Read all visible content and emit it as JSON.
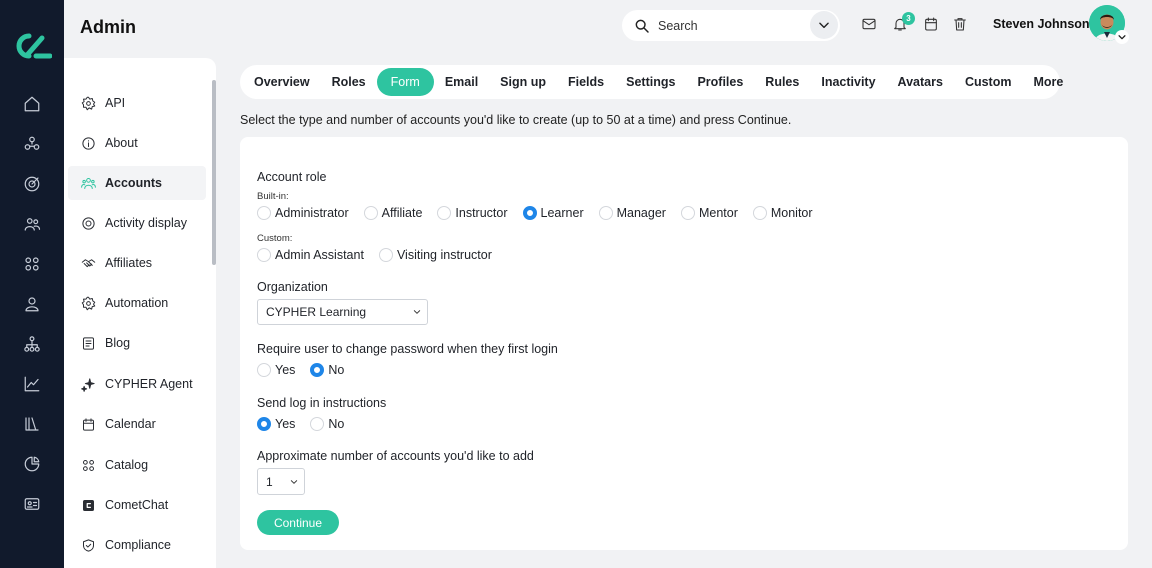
{
  "app": {
    "title": "Admin"
  },
  "header": {
    "search_placeholder": "Search",
    "notifications_count": "3",
    "user_name": "Steven Johnson"
  },
  "rail": {
    "icons": [
      "home-icon",
      "network-icon",
      "target-icon",
      "users-icon",
      "grid-icon",
      "user-icon",
      "hierarchy-icon",
      "chart-icon",
      "library-icon",
      "pie-icon",
      "id-card-icon"
    ]
  },
  "subnav": {
    "items": [
      {
        "label": "API",
        "icon": "gear-icon"
      },
      {
        "label": "About",
        "icon": "info-icon"
      },
      {
        "label": "Accounts",
        "icon": "users-icon",
        "active": true
      },
      {
        "label": "Activity display",
        "icon": "target-icon"
      },
      {
        "label": "Affiliates",
        "icon": "handshake-icon"
      },
      {
        "label": "Automation",
        "icon": "gear-icon"
      },
      {
        "label": "Blog",
        "icon": "document-icon"
      },
      {
        "label": "CYPHER Agent",
        "icon": "sparkle-icon"
      },
      {
        "label": "Calendar",
        "icon": "calendar-icon"
      },
      {
        "label": "Catalog",
        "icon": "grid-icon"
      },
      {
        "label": "CometChat",
        "icon": "chat-icon"
      },
      {
        "label": "Compliance",
        "icon": "shield-icon"
      }
    ]
  },
  "tabs": [
    "Overview",
    "Roles",
    "Form",
    "Email",
    "Sign up",
    "Fields",
    "Settings",
    "Profiles",
    "Rules",
    "Inactivity",
    "Avatars",
    "Custom",
    "More"
  ],
  "active_tab": "Form",
  "instructions": "Select the type and number of accounts you'd like to create (up to 50 at a time) and press Continue.",
  "form": {
    "account_role_label": "Account role",
    "builtin_label": "Built-in:",
    "builtin_roles": [
      "Administrator",
      "Affiliate",
      "Instructor",
      "Learner",
      "Manager",
      "Mentor",
      "Monitor"
    ],
    "selected_role": "Learner",
    "custom_label": "Custom:",
    "custom_roles": [
      "Admin Assistant",
      "Visiting instructor"
    ],
    "organization_label": "Organization",
    "organization_value": "CYPHER Learning",
    "password_label": "Require user to change password when they first login",
    "password_options": [
      "Yes",
      "No"
    ],
    "password_selected": "No",
    "instructions_label": "Send log in instructions",
    "instructions_options": [
      "Yes",
      "No"
    ],
    "instructions_selected": "Yes",
    "count_label": "Approximate number of accounts you'd like to add",
    "count_value": "1",
    "continue_label": "Continue"
  },
  "colors": {
    "accent": "#2ec4a0",
    "rail": "#111a2c",
    "radio": "#1f86e8"
  }
}
